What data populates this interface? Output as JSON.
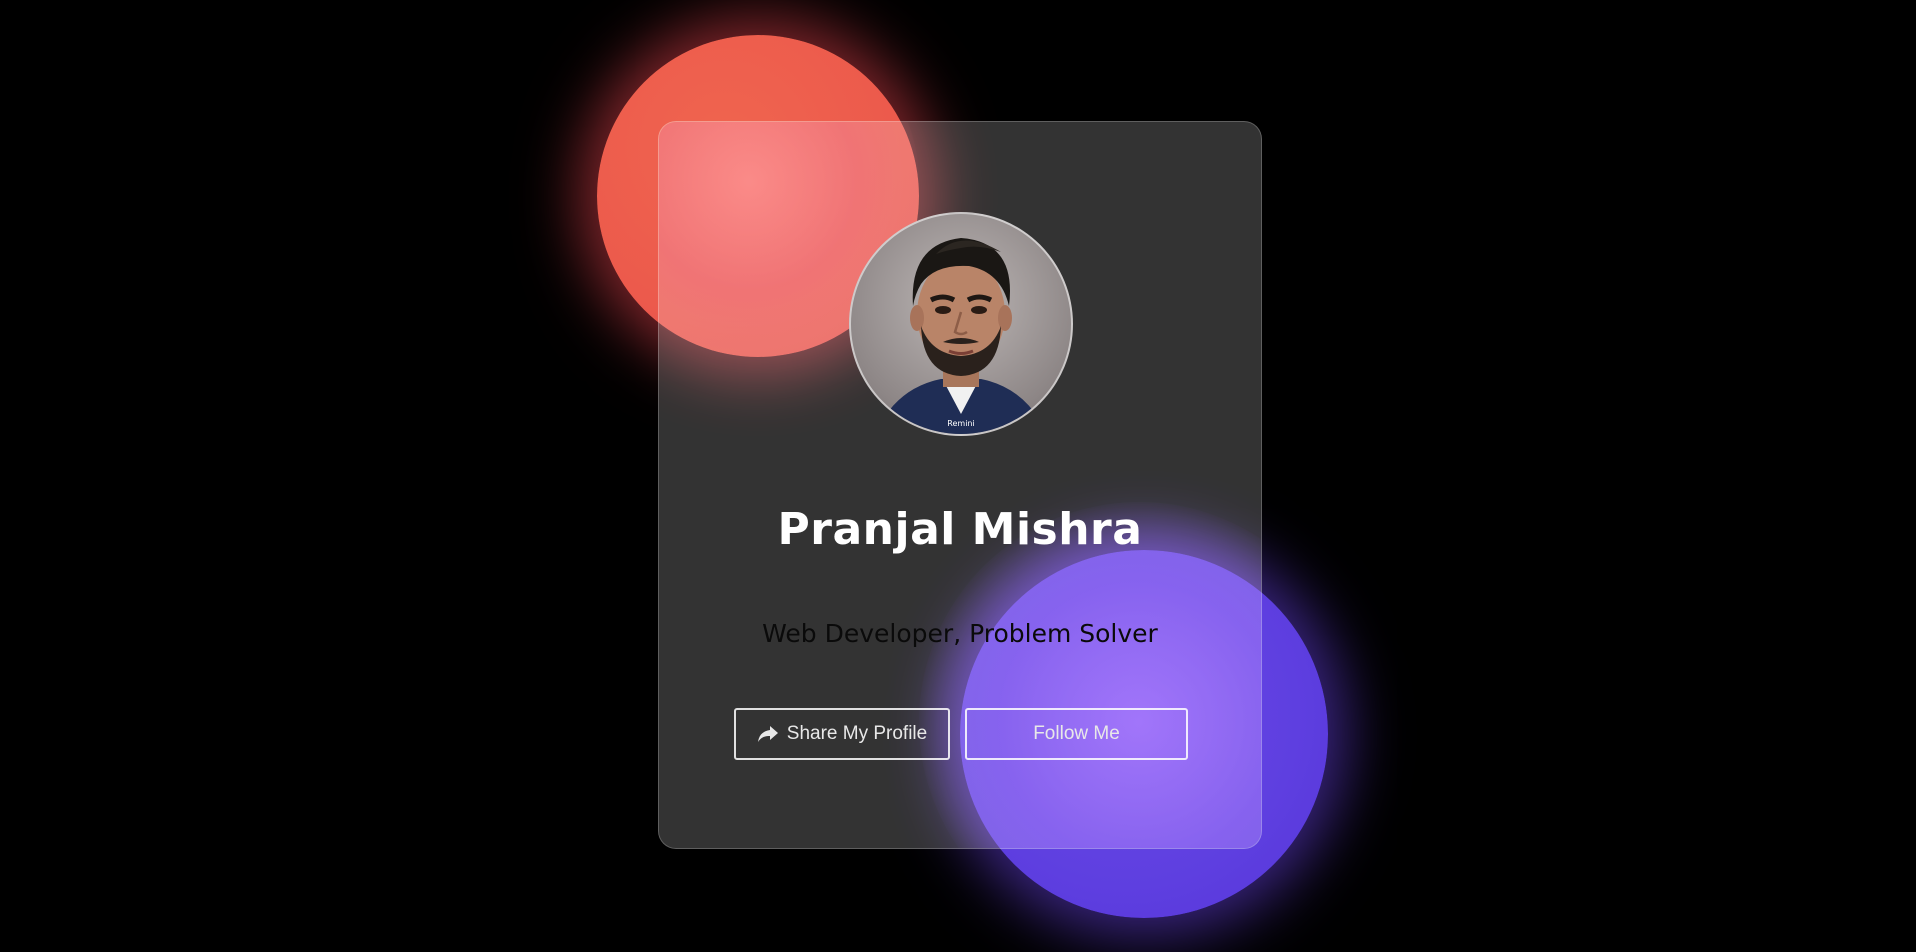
{
  "colors": {
    "background": "#000000",
    "blob_red": "#ec5a4c",
    "blob_purple": "#5e3fe0",
    "card": "rgba(255,255,255,0.2)",
    "name_text": "#ffffff",
    "tagline_text": "#0a0a0a"
  },
  "profile": {
    "name": "Pranjal Mishra",
    "tagline": "Web Developer, Problem Solver",
    "avatar_caption": "Remini"
  },
  "actions": {
    "share_label": "Share My Profile",
    "share_icon": "share-arrow-icon",
    "follow_label": "Follow Me"
  }
}
